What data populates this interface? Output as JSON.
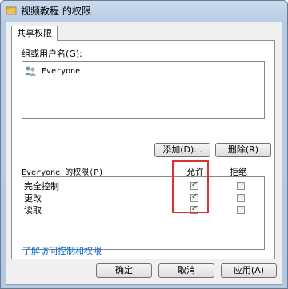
{
  "window": {
    "title": "视频教程 的权限"
  },
  "tabs": [
    {
      "label": "共享权限"
    }
  ],
  "users_section": {
    "label": "组或用户名(G):",
    "items": [
      {
        "name": "Everyone"
      }
    ]
  },
  "buttons": {
    "add": "添加(D)...",
    "remove": "删除(R)",
    "ok": "确定",
    "cancel": "取消",
    "apply": "应用(A)"
  },
  "permissions": {
    "label": "Everyone 的权限(P)",
    "allow_header": "允许",
    "deny_header": "拒绝",
    "rows": [
      {
        "name": "完全控制",
        "allow": true,
        "deny": false
      },
      {
        "name": "更改",
        "allow": true,
        "deny": false
      },
      {
        "name": "读取",
        "allow": true,
        "deny": false
      }
    ]
  },
  "link": {
    "text": "了解访问控制和权限"
  },
  "colors": {
    "highlight": "#e03030",
    "link": "#0066cc"
  }
}
